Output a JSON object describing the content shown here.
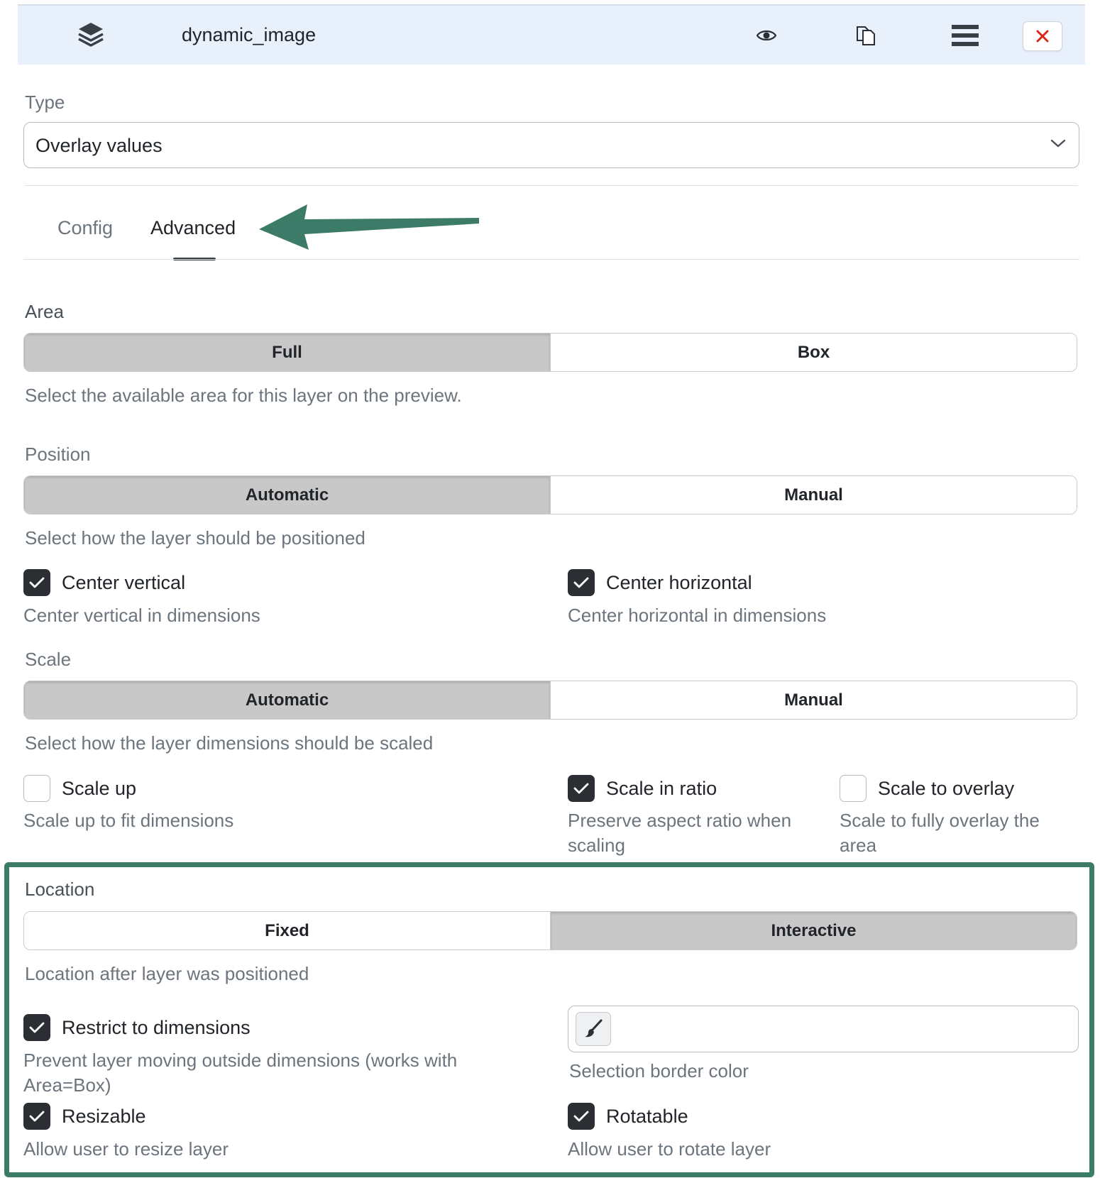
{
  "header": {
    "title": "dynamic_image",
    "icons": [
      "layers-icon",
      "eye-icon",
      "copy-icon",
      "menu-icon",
      "close-icon"
    ],
    "close_color": "#d9281a"
  },
  "type": {
    "label": "Type",
    "value": "Overlay values"
  },
  "tabs": [
    {
      "label": "Config",
      "active": false
    },
    {
      "label": "Advanced",
      "active": true
    }
  ],
  "area": {
    "label": "Area",
    "options": [
      "Full",
      "Box"
    ],
    "selected": "Full",
    "hint": "Select the available area for this layer on the preview."
  },
  "position": {
    "label": "Position",
    "options": [
      "Automatic",
      "Manual"
    ],
    "selected": "Automatic",
    "hint": "Select how the layer should be positioned",
    "checks": [
      {
        "label": "Center vertical",
        "desc": "Center vertical in dimensions",
        "checked": true
      },
      {
        "label": "Center horizontal",
        "desc": "Center horizontal in dimensions",
        "checked": true
      }
    ]
  },
  "scale": {
    "label": "Scale",
    "options": [
      "Automatic",
      "Manual"
    ],
    "selected": "Automatic",
    "hint": "Select how the layer dimensions should be scaled",
    "checks": [
      {
        "label": "Scale up",
        "desc": "Scale up to fit dimensions",
        "checked": false
      },
      {
        "label": "Scale in ratio",
        "desc_1": "Preserve aspect ratio when",
        "desc_2": "scaling",
        "checked": true
      },
      {
        "label": "Scale to overlay",
        "desc_1": "Scale to fully overlay the",
        "desc_2": "area",
        "checked": false
      }
    ]
  },
  "location": {
    "label": "Location",
    "options": [
      "Fixed",
      "Interactive"
    ],
    "selected": "Interactive",
    "hint": "Location after layer was positioned",
    "restrict": {
      "label": "Restrict to dimensions",
      "desc_1": "Prevent layer moving outside dimensions (works with",
      "desc_2": "Area=Box)",
      "checked": true
    },
    "border_color": {
      "desc": "Selection border color"
    },
    "resizable": {
      "label": "Resizable",
      "desc": "Allow user to resize layer",
      "checked": true
    },
    "rotatable": {
      "label": "Rotatable",
      "desc": "Allow user to rotate layer",
      "checked": true
    }
  },
  "colors": {
    "accent_frame": "#3b7b68",
    "arrow": "#3b7b68"
  }
}
